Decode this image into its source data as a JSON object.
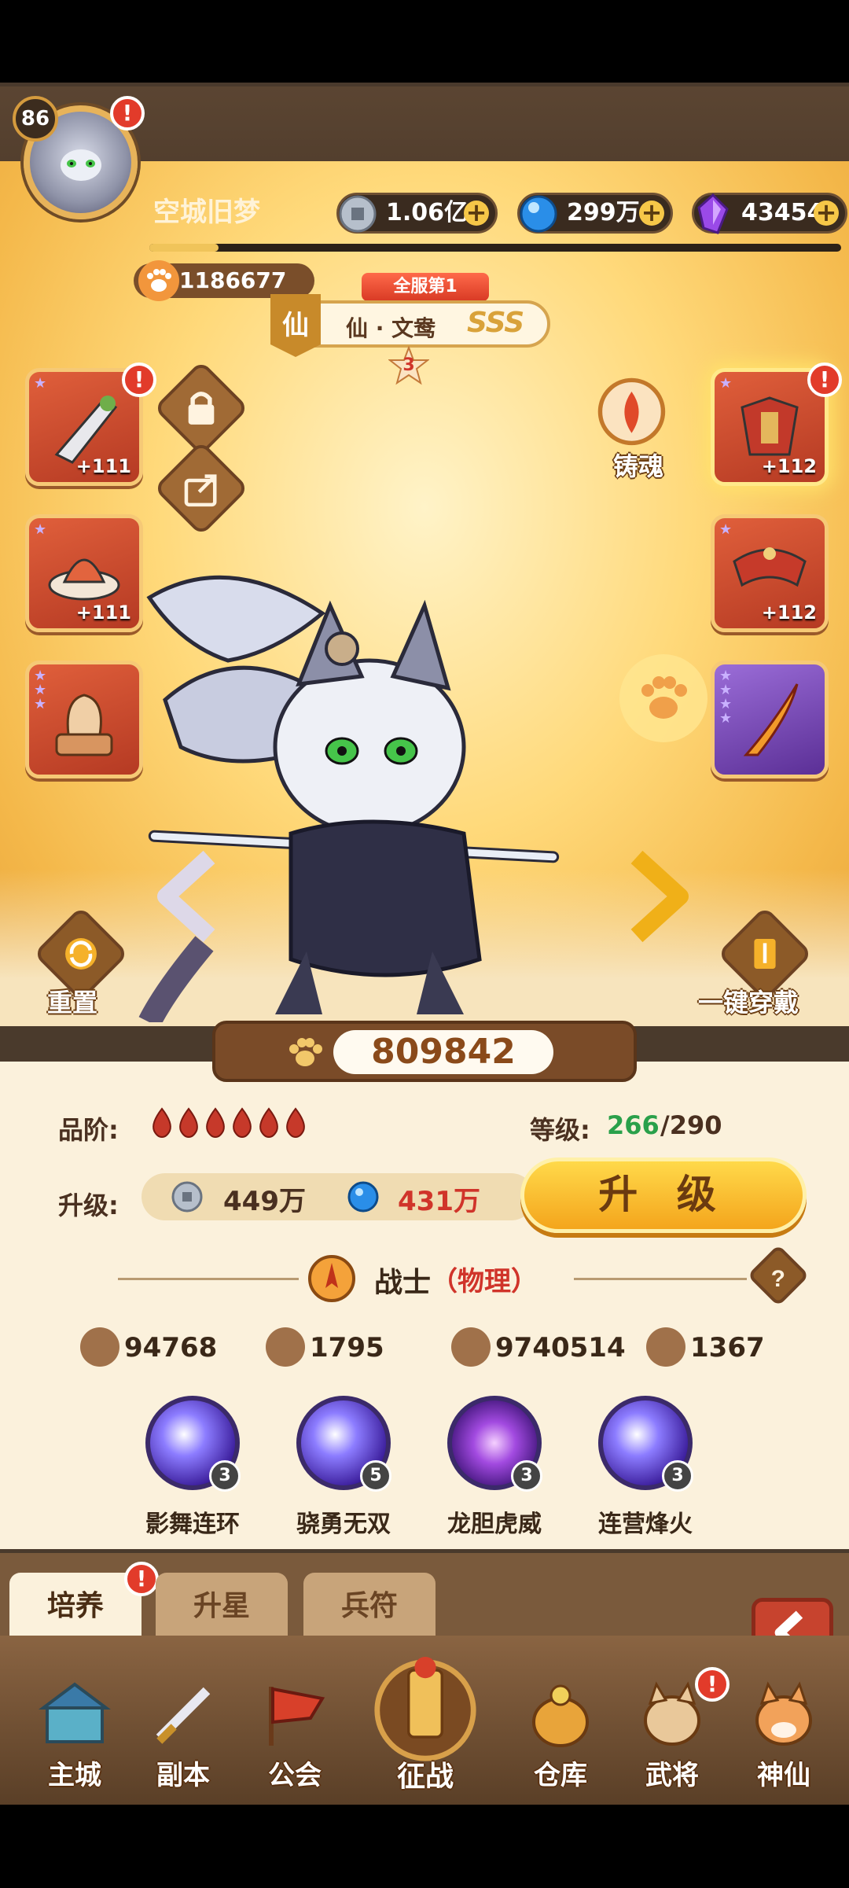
{
  "player": {
    "level": "86",
    "name": "空城旧梦",
    "power": "1186677"
  },
  "currencies": [
    {
      "name": "coin",
      "value": "1.06亿",
      "icon": "coin-icon",
      "color": "#cfd6e0"
    },
    {
      "name": "gem",
      "value": "299万",
      "icon": "blue-orb-icon",
      "color": "#3aa0f0"
    },
    {
      "name": "crystal",
      "value": "43454",
      "icon": "purple-crystal-icon",
      "color": "#9a4ae8"
    }
  ],
  "hero": {
    "server_rank": "全服第1",
    "type_badge": "仙",
    "title": "仙 · 文鸯",
    "grade": "SSS",
    "stars": "3",
    "combat_power": "809842"
  },
  "equipment": {
    "left": [
      {
        "name": "weapon",
        "level": "+111",
        "icon": "broadsword-icon"
      },
      {
        "name": "helmet",
        "level": "+111",
        "icon": "war-hat-icon"
      },
      {
        "name": "mount",
        "level": "",
        "icon": "fox-figure-icon"
      }
    ],
    "right": [
      {
        "name": "armor",
        "level": "+112",
        "icon": "armor-icon"
      },
      {
        "name": "shoulder",
        "level": "+112",
        "icon": "shoulder-armor-icon"
      },
      {
        "name": "blade",
        "level": "",
        "icon": "flame-blade-icon"
      }
    ]
  },
  "actions": {
    "forge_soul": "铸魂",
    "reset": "重置",
    "equip_all": "一键穿戴"
  },
  "stats": {
    "quality_label": "品阶:",
    "level_label": "等级:",
    "level_current": "266",
    "level_max": "/290",
    "upgrade_label": "升级:",
    "cost_coin": "449万",
    "cost_orb": "431万",
    "upgrade_button": "升 级",
    "class_name": "战士",
    "class_type": "（物理）",
    "attack": "94768",
    "defense": "1795",
    "hp": "9740514",
    "speed": "1367",
    "quality_flames": 6
  },
  "skills": [
    {
      "name": "影舞连环",
      "level": "3"
    },
    {
      "name": "骁勇无双",
      "level": "5"
    },
    {
      "name": "龙胆虎威",
      "level": "3"
    },
    {
      "name": "连营烽火",
      "level": "3"
    }
  ],
  "tabs": [
    {
      "label": "培养",
      "active": true
    },
    {
      "label": "升星",
      "active": false
    },
    {
      "label": "兵符",
      "active": false
    }
  ],
  "nav": [
    {
      "label": "主城",
      "icon": "city-icon"
    },
    {
      "label": "副本",
      "icon": "sword-icon"
    },
    {
      "label": "公会",
      "icon": "flag-icon"
    },
    {
      "label": "征战",
      "icon": "battle-icon"
    },
    {
      "label": "仓库",
      "icon": "bag-icon"
    },
    {
      "label": "武将",
      "icon": "cat-general-icon"
    },
    {
      "label": "神仙",
      "icon": "cat-immortal-icon"
    }
  ]
}
